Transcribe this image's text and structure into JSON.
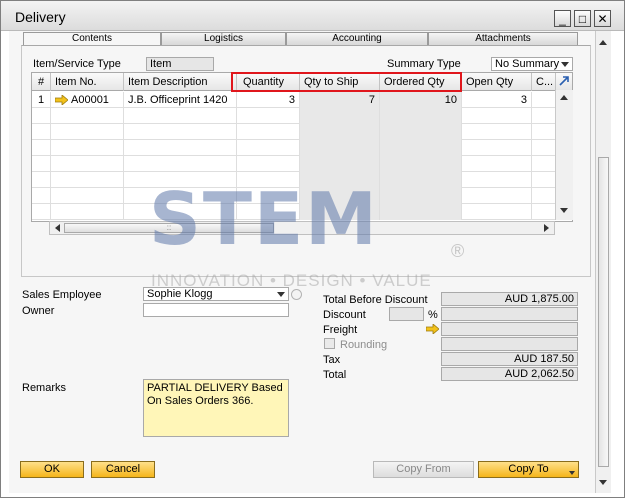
{
  "window": {
    "title": "Delivery",
    "min": "_",
    "max": "□",
    "close": "✕"
  },
  "tabs": [
    "Contents",
    "Logistics",
    "Accounting",
    "Attachments"
  ],
  "item_service_type": {
    "label": "Item/Service Type",
    "value": "Item"
  },
  "summary_type": {
    "label": "Summary Type",
    "value": "No Summary"
  },
  "grid": {
    "headers": [
      "#",
      "Item No.",
      "Item Description",
      "Quantity",
      "Qty to Ship",
      "Ordered Qty",
      "Open Qty",
      "C..."
    ],
    "rows": [
      {
        "num": "1",
        "item_no": "A00001",
        "description": "J.B. Officeprint 1420",
        "quantity": "3",
        "qty_to_ship": "7",
        "ordered_qty": "10",
        "open_qty": "3",
        "c": ""
      }
    ],
    "scroll_mid": "::"
  },
  "watermark": {
    "text": "STEM",
    "tagline": "INNOVATION • DESIGN • VALUE",
    "reg": "®"
  },
  "sales_employee": {
    "label": "Sales Employee",
    "value": "Sophie Klogg"
  },
  "owner": {
    "label": "Owner",
    "value": ""
  },
  "remarks": {
    "label": "Remarks",
    "value": "PARTIAL DELIVERY Based On Sales Orders 366."
  },
  "totals": {
    "total_before_discount": {
      "label": "Total Before Discount",
      "value": "AUD 1,875.00"
    },
    "discount": {
      "label": "Discount",
      "value": "",
      "pct": "%"
    },
    "freight": {
      "label": "Freight",
      "value": ""
    },
    "rounding": {
      "label": "Rounding",
      "value": ""
    },
    "tax": {
      "label": "Tax",
      "value": "AUD 187.50"
    },
    "total": {
      "label": "Total",
      "value": "AUD 2,062.50"
    }
  },
  "buttons": {
    "ok": "OK",
    "cancel": "Cancel",
    "copy_from": "Copy From",
    "copy_to": "Copy To"
  },
  "colors": {
    "button_yellow": "#f5b51a",
    "highlight_red": "#e0161c",
    "link_arrow": "#f2c21b"
  }
}
